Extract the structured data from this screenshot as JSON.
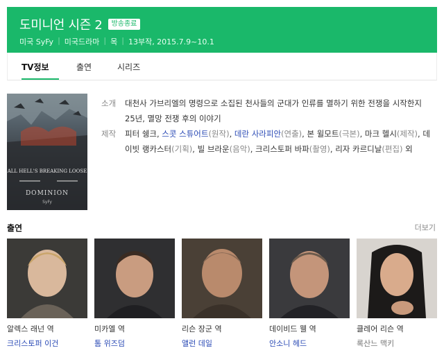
{
  "show": {
    "title": "도미니언 시즌 2",
    "badge": "방송종료",
    "meta": [
      "미국 SyFy",
      "미국드라마",
      "목",
      "13부작, 2015.7.9~10.1"
    ]
  },
  "tabs": [
    {
      "label": "TV정보",
      "active": true
    },
    {
      "label": "출연",
      "active": false
    },
    {
      "label": "시리즈",
      "active": false
    }
  ],
  "poster": {
    "tagline": "ALL HELL'S BREAKING LOOSE",
    "logo": "DOMINION",
    "network": "SyFy",
    "colors": {
      "sky": "#6f7d82",
      "dark": "#1d1f22",
      "fire": "#d9472b"
    }
  },
  "info": {
    "synopsis_label": "소개",
    "synopsis": "대천사 가브리엘의 명령으로 소집된 천사들의 군대가 인류를 멸하기 위한 전쟁을 시작한지 25년, 멸망 전쟁 후의 이야기",
    "credits_label": "제작",
    "credits": [
      {
        "name": "피터 쉥크",
        "role": "",
        "link": false
      },
      {
        "name": "스콧 스튜어트",
        "role": "(원작)",
        "link": true
      },
      {
        "name": "데란 사라피안",
        "role": "(연출)",
        "link": true
      },
      {
        "name": "본 윌모트",
        "role": "(극본)",
        "link": false
      },
      {
        "name": "마크 헬시",
        "role": "(제작)",
        "link": false
      },
      {
        "name": "데이빗 랭카스터",
        "role": "(기획)",
        "link": false
      },
      {
        "name": "빌 브라운",
        "role": "(음악)",
        "link": false
      },
      {
        "name": "크리스토퍼 바파",
        "role": "(촬영)",
        "link": false
      },
      {
        "name": "리자 카르디날",
        "role": "(편집)",
        "link": false
      }
    ],
    "credits_suffix": "외"
  },
  "cast_section": {
    "title": "출연",
    "more": "더보기"
  },
  "cast": [
    {
      "role": "알렉스 래넌 역",
      "actor": "크리스토퍼 이건",
      "linked": true
    },
    {
      "role": "미카엘 역",
      "actor": "톰 위즈덤",
      "linked": true
    },
    {
      "role": "리슨 장군 역",
      "actor": "앨런 데일",
      "linked": true
    },
    {
      "role": "데이비드 웰 역",
      "actor": "안소니 헤드",
      "linked": true
    },
    {
      "role": "클레어 리슨 역",
      "actor": "록산느 맥키",
      "linked": false
    }
  ],
  "colors": {
    "accent": "#1ab86a",
    "link": "#2a4ab5"
  }
}
